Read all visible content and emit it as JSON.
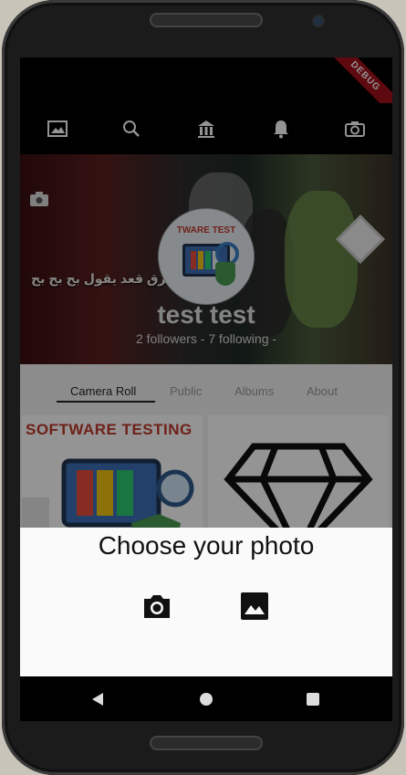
{
  "app": {
    "debug_banner": "DEBUG",
    "appbar_icons": [
      "image-icon",
      "search-icon",
      "bank-icon",
      "bell-icon",
      "camera-icon"
    ]
  },
  "profile": {
    "cover_text": "يفرق قعد يقول بح بح بح",
    "avatar_banner": "TWARE TEST",
    "name": "test test",
    "stats": "2 followers - 7 following -"
  },
  "tabs": [
    {
      "label": "Camera Roll",
      "active": true
    },
    {
      "label": "Public",
      "active": false
    },
    {
      "label": "Albums",
      "active": false
    },
    {
      "label": "About",
      "active": false
    }
  ],
  "grid": {
    "tile1_title": "SOFTWARE TESTING"
  },
  "sheet": {
    "title": "Choose your photo",
    "actions": [
      "camera-icon",
      "photo-icon"
    ]
  },
  "nav": [
    "back-icon",
    "home-icon",
    "recents-icon"
  ],
  "colors": {
    "debug": "#a0101a",
    "appbar": "#000000",
    "sheet": "#fafafa",
    "title_red": "#c0392b"
  }
}
